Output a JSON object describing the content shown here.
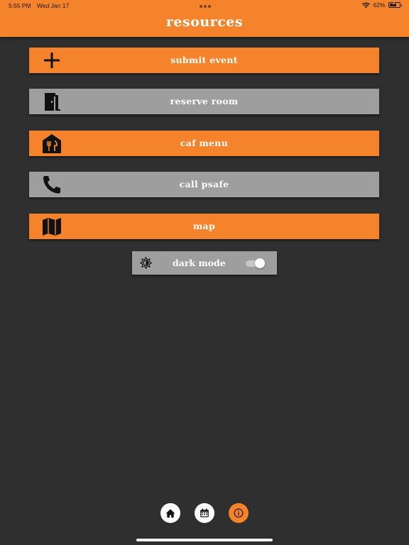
{
  "status_bar": {
    "time": "5:55 PM",
    "date": "Wed Jan 17",
    "battery_percent": "62%",
    "battery_level": 0.62
  },
  "header": {
    "title": "resources",
    "background_color": "#f5832b"
  },
  "menu": {
    "items": [
      {
        "label": "submit event",
        "icon": "plus-icon",
        "color": "#f5832b"
      },
      {
        "label": "reserve room",
        "icon": "door-icon",
        "color": "#9e9e9e"
      },
      {
        "label": "caf menu",
        "icon": "restaurant-icon",
        "color": "#f5832b"
      },
      {
        "label": "call psafe",
        "icon": "phone-icon",
        "color": "#9e9e9e"
      },
      {
        "label": "map",
        "icon": "map-icon",
        "color": "#f5832b"
      }
    ]
  },
  "dark_mode": {
    "label": "dark mode",
    "icon": "brightness-icon",
    "enabled": true
  },
  "bottom_nav": {
    "items": [
      {
        "name": "home",
        "icon": "home-icon",
        "active": false
      },
      {
        "name": "calendar",
        "icon": "calendar-icon",
        "active": false
      },
      {
        "name": "info",
        "icon": "info-icon",
        "active": true
      }
    ],
    "active_color": "#f5832b"
  },
  "colors": {
    "background": "#2f2f2f",
    "accent": "#f5832b",
    "secondary": "#9e9e9e"
  }
}
